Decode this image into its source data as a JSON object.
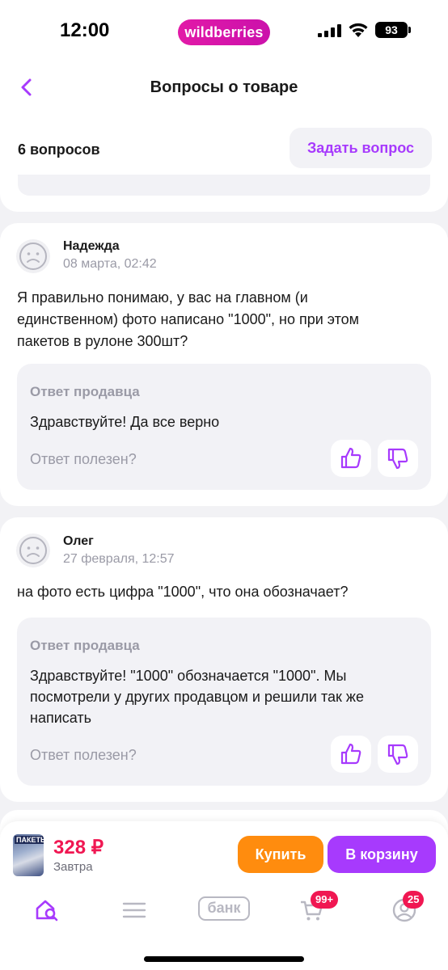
{
  "status_bar": {
    "time": "12:00",
    "brand": "wildberries",
    "battery": "93"
  },
  "header": {
    "title": "Вопросы о товаре",
    "question_count": "6 вопросов",
    "ask_button": "Задать вопрос"
  },
  "questions": [
    {
      "author": "Надежда",
      "date": "08 марта, 02:42",
      "text_lines": [
        "Я правильно понимаю, у вас на главном (и",
        "единственном) фото написано \"1000\", но при этом",
        "пакетов в рулоне 300шт?"
      ],
      "answer_title": "Ответ продавца",
      "answer_lines": [
        "Здравствуйте! Да все верно"
      ],
      "helpful": "Ответ полезен?"
    },
    {
      "author": "Олег",
      "date": "27 февраля, 12:57",
      "text_lines": [
        "на фото есть цифра \"1000\", что она обозначает?"
      ],
      "answer_title": "Ответ продавца",
      "answer_lines": [
        "Здравствуйте! \"1000\" обозначается \"1000\". Мы",
        "посмотрели у других продавцом и решили так же",
        "написать"
      ],
      "helpful": "Ответ полезен?"
    }
  ],
  "product_bar": {
    "thumb_label": "ПАКЕТЫ",
    "price": "328 ₽",
    "delivery": "Завтра",
    "buy_button": "Купить",
    "cart_button": "В корзину"
  },
  "nav": {
    "bank_label": "банк",
    "cart_badge": "99+",
    "profile_badge": "25"
  },
  "colors": {
    "accent": "#a73afd",
    "brand_pink": "#cb11ab",
    "price_red": "#f01752",
    "buy_orange": "#ff8c0e"
  }
}
